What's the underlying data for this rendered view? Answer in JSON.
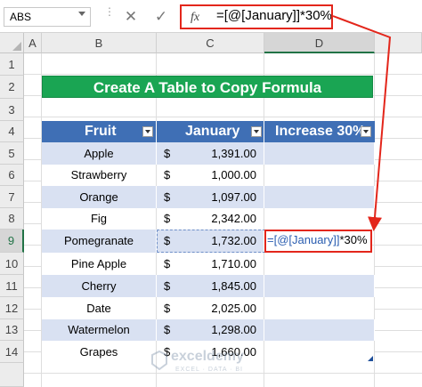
{
  "formula_bar": {
    "name_box": "ABS",
    "cancel_icon": "✕",
    "enter_icon": "✓",
    "fx_label": "fx",
    "formula": "=[@[January]]*30%"
  },
  "columns": [
    "A",
    "B",
    "C",
    "D"
  ],
  "rows": [
    "1",
    "2",
    "3",
    "4",
    "5",
    "6",
    "7",
    "8",
    "9",
    "10",
    "11",
    "12",
    "13",
    "14"
  ],
  "title": "Create A Table to Copy Formula",
  "table": {
    "headers": [
      "Fruit",
      "January",
      "Increase 30%"
    ],
    "currency": "$",
    "rows": [
      {
        "fruit": "Apple",
        "january": "1,391.00",
        "increase": ""
      },
      {
        "fruit": "Strawberry",
        "january": "1,000.00",
        "increase": ""
      },
      {
        "fruit": "Orange",
        "january": "1,097.00",
        "increase": ""
      },
      {
        "fruit": "Fig",
        "january": "2,342.00",
        "increase": ""
      },
      {
        "fruit": "Pomegranate",
        "january": "1,732.00",
        "increase": "=[@[January]]*30%"
      },
      {
        "fruit": "Pine Apple",
        "january": "1,710.00",
        "increase": ""
      },
      {
        "fruit": "Cherry",
        "january": "1,845.00",
        "increase": ""
      },
      {
        "fruit": "Date",
        "january": "2,025.00",
        "increase": ""
      },
      {
        "fruit": "Watermelon",
        "january": "1,298.00",
        "increase": ""
      },
      {
        "fruit": "Grapes",
        "january": "1,660.00",
        "increase": ""
      }
    ]
  },
  "active_cell_formula": {
    "ref_part": "=[@[January]]",
    "rest": "*30%"
  },
  "watermark": {
    "name": "exceldemy",
    "tagline": "EXCEL · DATA · BI"
  },
  "colors": {
    "title_bg": "#1aa553",
    "header_bg": "#3f6fb5",
    "band": "#d9e1f2",
    "highlight": "#e3261b"
  }
}
